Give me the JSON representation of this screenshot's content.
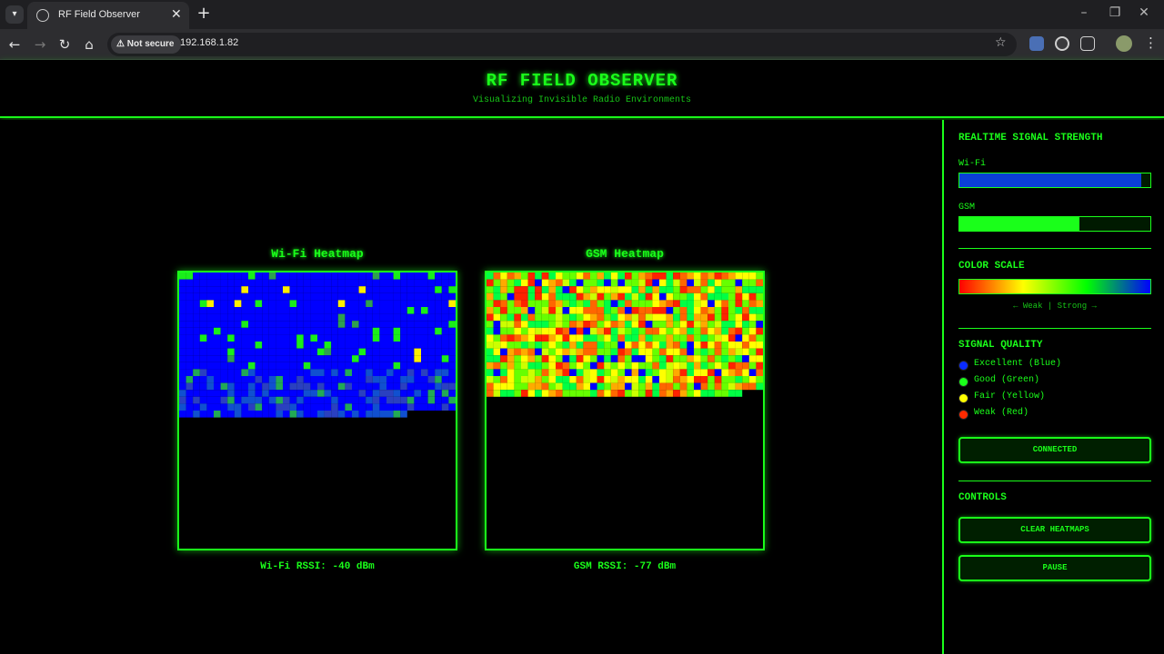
{
  "browser": {
    "tab_title": "RF Field Observer",
    "security_label": "Not secure",
    "url": "192.168.1.82"
  },
  "app": {
    "title": "RF FIELD OBSERVER",
    "subtitle": "Visualizing Invisible Radio Environments"
  },
  "heatmaps": {
    "wifi": {
      "title": "Wi-Fi Heatmap",
      "rssi_label": "Wi-Fi RSSI: -40 dBm"
    },
    "gsm": {
      "title": "GSM Heatmap",
      "rssi_label": "GSM RSSI: -77 dBm"
    }
  },
  "sidebar": {
    "signal_heading": "REALTIME SIGNAL STRENGTH",
    "wifi_label": "Wi-Fi",
    "wifi_level": 0.95,
    "wifi_color": "#0a3fd8",
    "gsm_label": "GSM",
    "gsm_level": 0.63,
    "gsm_color": "#1aff1a",
    "scale_heading": "COLOR SCALE",
    "scale_caption": "← Weak | Strong →",
    "quality_heading": "SIGNAL QUALITY",
    "quality": [
      {
        "label": "Excellent (Blue)",
        "color": "#0a2bff"
      },
      {
        "label": "Good (Green)",
        "color": "#1aff1a"
      },
      {
        "label": "Fair (Yellow)",
        "color": "#ffff00"
      },
      {
        "label": "Weak (Red)",
        "color": "#ff2a00"
      }
    ],
    "status_button": "CONNECTED",
    "controls_heading": "CONTROLS",
    "clear_button": "CLEAR HEATMAPS",
    "pause_button": "PAUSE"
  },
  "colors": {
    "accent": "#1aff1a",
    "background": "#000000"
  }
}
